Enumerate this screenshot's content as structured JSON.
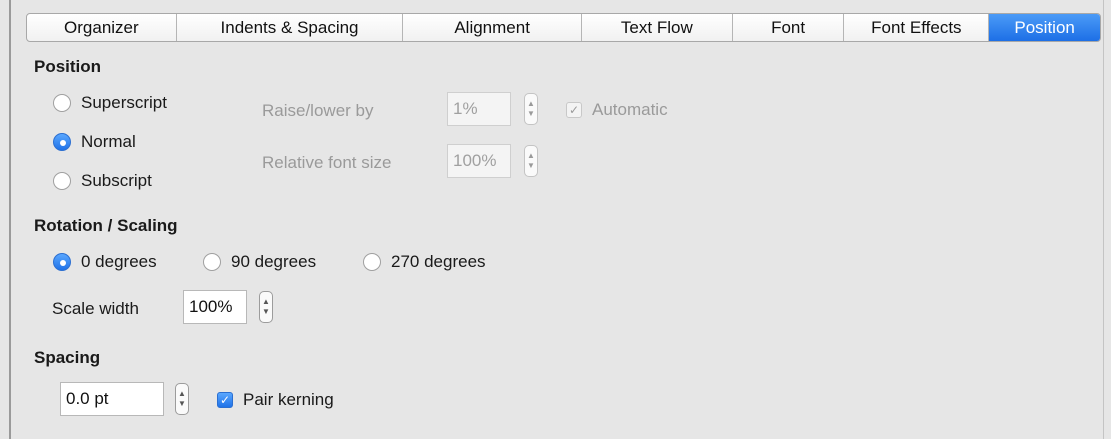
{
  "tabs": [
    {
      "label": "Organizer",
      "active": false
    },
    {
      "label": "Indents & Spacing",
      "active": false
    },
    {
      "label": "Alignment",
      "active": false
    },
    {
      "label": "Text Flow",
      "active": false
    },
    {
      "label": "Font",
      "active": false
    },
    {
      "label": "Font Effects",
      "active": false
    },
    {
      "label": "Position",
      "active": true
    }
  ],
  "position": {
    "title": "Position",
    "options": [
      "Superscript",
      "Normal",
      "Subscript"
    ],
    "selected": "Normal",
    "raise_lower_label": "Raise/lower by",
    "raise_lower_value": "1%",
    "automatic_label": "Automatic",
    "automatic_checked": true,
    "relative_size_label": "Relative font size",
    "relative_size_value": "100%"
  },
  "rotation": {
    "title": "Rotation / Scaling",
    "options": [
      "0 degrees",
      "90 degrees",
      "270 degrees"
    ],
    "selected": "0 degrees",
    "scale_width_label": "Scale width",
    "scale_width_value": "100%"
  },
  "spacing": {
    "title": "Spacing",
    "value": "0.0 pt",
    "pair_kerning_label": "Pair kerning",
    "pair_kerning_checked": true
  },
  "colors": {
    "accent": "#1f72e8",
    "background": "#e6e6e6",
    "disabled_text": "#9a9a9a"
  }
}
